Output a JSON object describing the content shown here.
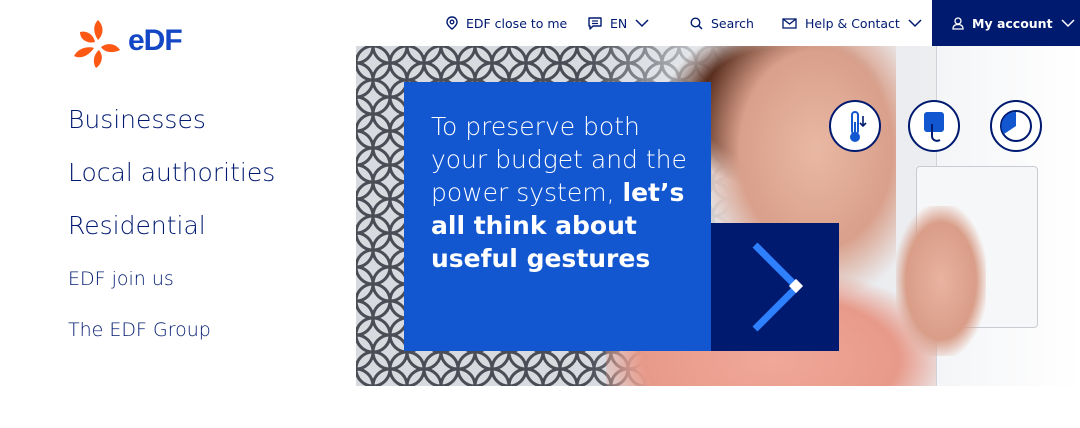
{
  "brand": {
    "logo_text": "eDF",
    "logo_colors": {
      "petals": "#fe5815",
      "word": "#1447c5"
    }
  },
  "nav": {
    "items": [
      {
        "label": "Businesses"
      },
      {
        "label": "Local authorities"
      },
      {
        "label": "Residential"
      },
      {
        "label": "EDF join us"
      },
      {
        "label": "The EDF Group"
      }
    ]
  },
  "topbar": {
    "close_to_me": "EDF close to me",
    "language": "EN",
    "search": "Search",
    "help": "Help & Contact",
    "account": "My account"
  },
  "hero": {
    "headline_regular": "To preserve both your budget and the power system,",
    "headline_bold": "let’s all think about useful gestures",
    "pictograms": [
      "thermometer-icon",
      "button-press-icon",
      "timer-icon"
    ]
  },
  "colors": {
    "navy": "#001a70",
    "blue": "#1257d0",
    "orange": "#fe5815",
    "arrow_light": "#2f80ff"
  }
}
